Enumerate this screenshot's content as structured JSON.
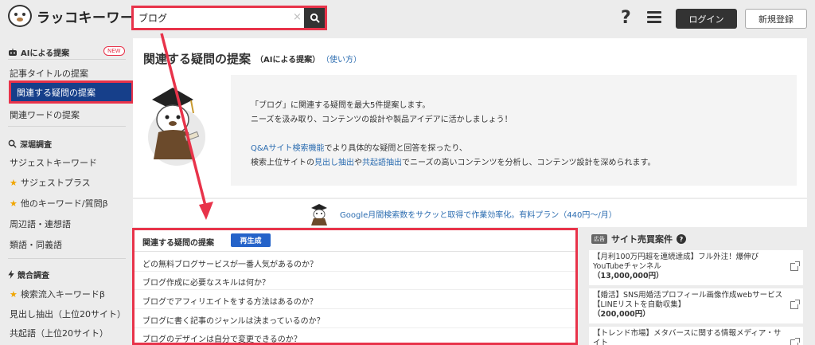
{
  "header": {
    "logo_text": "ラッコキーワード",
    "search_value": "ブログ",
    "search_clear": "×",
    "help_glyph": "?",
    "login_label": "ログイン",
    "signup_label": "新規登録"
  },
  "sidebar": {
    "ai_section": "AIによる提案",
    "new_badge": "NEW",
    "ai_items": [
      "記事タイトルの提案",
      "関連する疑問の提案",
      "関連ワードの提案"
    ],
    "deep_section": "深堀調査",
    "deep_items": [
      "サジェストキーワード",
      "サジェストプラス",
      "他のキーワード/質問β",
      "周辺語・連想語",
      "類語・同義語"
    ],
    "comp_section": "競合調査",
    "comp_items": [
      "検索流入キーワードβ",
      "見出し抽出（上位20サイト）",
      "共起語（上位20サイト）"
    ]
  },
  "main": {
    "title": "関連する疑問の提案",
    "subtitle": "（AIによる提案）",
    "howto": "（使い方）",
    "intro": {
      "line1": "「ブログ」に関連する疑問を最大5件提案します。",
      "line2": "ニーズを汲み取り、コンテンツの設計や製品アイデアに活かしましょう！",
      "line3_link": "Q&Aサイト検索機能",
      "line3_rest": "でより具体的な疑問と回答を探ったり、",
      "line4_a": "検索上位サイトの",
      "line4_link1": "見出し抽出",
      "line4_b": "や",
      "line4_link2": "共起語抽出",
      "line4_c": "でニーズの高いコンテンツを分析し、コンテンツ設計を深められます。"
    }
  },
  "banner": {
    "text": "Google月間検索数をサクッと取得で作業効率化。有料プラン（440円〜/月）"
  },
  "questions": {
    "heading": "関連する疑問の提案",
    "regen_label": "再生成",
    "items": [
      "どの無料ブログサービスが一番人気があるのか？",
      "ブログ作成に必要なスキルは何か？",
      "ブログでアフィリエイトをする方法はあるのか？",
      "ブログに書く記事のジャンルは決まっているのか？",
      "ブログのデザインは自分で変更できるのか？"
    ]
  },
  "sales": {
    "ad_badge": "広告",
    "title": "サイト売買案件",
    "help_glyph": "?",
    "items": [
      {
        "text": "【月利100万円超を連続達成】フル外注！爆伸びYouTubeチャンネル",
        "price": "（13,000,000円）"
      },
      {
        "text": "【婚活】SNS用婚活プロフィール画像作成webサービス【LINEリストを自動収集】",
        "price": "（200,000円）"
      },
      {
        "text": "【トレンド市場】メタバースに関する情報メディア・サイト",
        "price": ""
      }
    ]
  },
  "colors": {
    "annotation_red": "#e8334a",
    "active_nav": "#163f8a",
    "link_blue": "#2b6cb0",
    "regen_blue": "#2563c9"
  }
}
